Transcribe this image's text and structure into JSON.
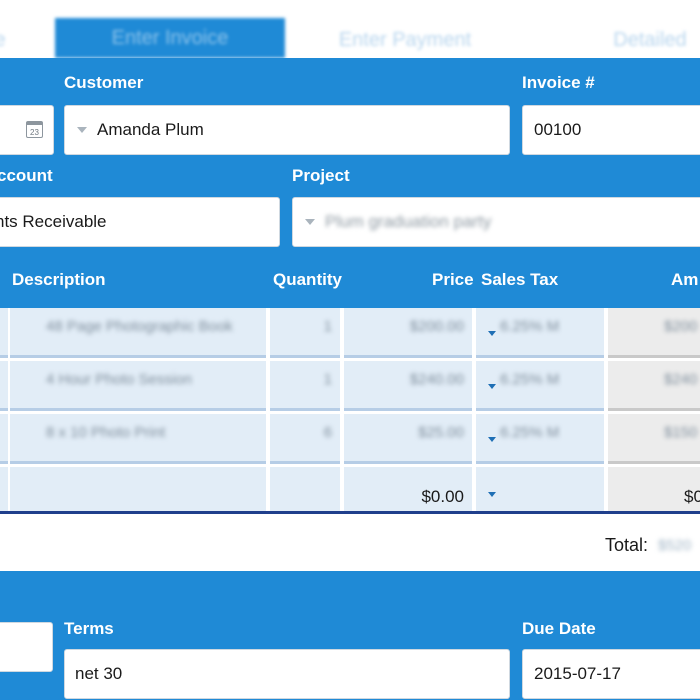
{
  "tabs": [
    {
      "label": "e",
      "active": false
    },
    {
      "label": "Enter Invoice",
      "active": true
    },
    {
      "label": "Enter Payment",
      "active": false
    },
    {
      "label": "Detailed",
      "active": false
    }
  ],
  "form": {
    "customer_label": "Customer",
    "customer_value": "Amanda Plum",
    "invoice_label": "Invoice #",
    "invoice_value": "00100",
    "date_icon_text": "23",
    "account_label": "ccount",
    "account_value": "nts Receivable",
    "project_label": "Project",
    "project_value": "Plum graduation party"
  },
  "table": {
    "headers": {
      "description": "Description",
      "quantity": "Quantity",
      "price": "Price",
      "sales_tax": "Sales Tax",
      "amount": "Am"
    },
    "rows": [
      {
        "description": "48 Page Photographic Book",
        "quantity": "1",
        "price": "$200.00",
        "tax": "6.25% M",
        "amount": "$200"
      },
      {
        "description": "4 Hour Photo Session",
        "quantity": "1",
        "price": "$240.00",
        "tax": "6.25% M",
        "amount": "$240"
      },
      {
        "description": "8 x 10 Photo Print",
        "quantity": "6",
        "price": "$25.00",
        "tax": "6.25% M",
        "amount": "$150"
      }
    ],
    "new_row_price": "$0.00",
    "new_row_amount": "$0"
  },
  "totals": {
    "label": "Total:",
    "value": "$520"
  },
  "footer": {
    "terms_label": "Terms",
    "terms_value": "net 30",
    "due_label": "Due Date",
    "due_value": "2015-07-17"
  },
  "colors": {
    "primary": "#1f8ad6",
    "row_bg": "#e2edf7",
    "total_line": "#1f3f8c"
  }
}
